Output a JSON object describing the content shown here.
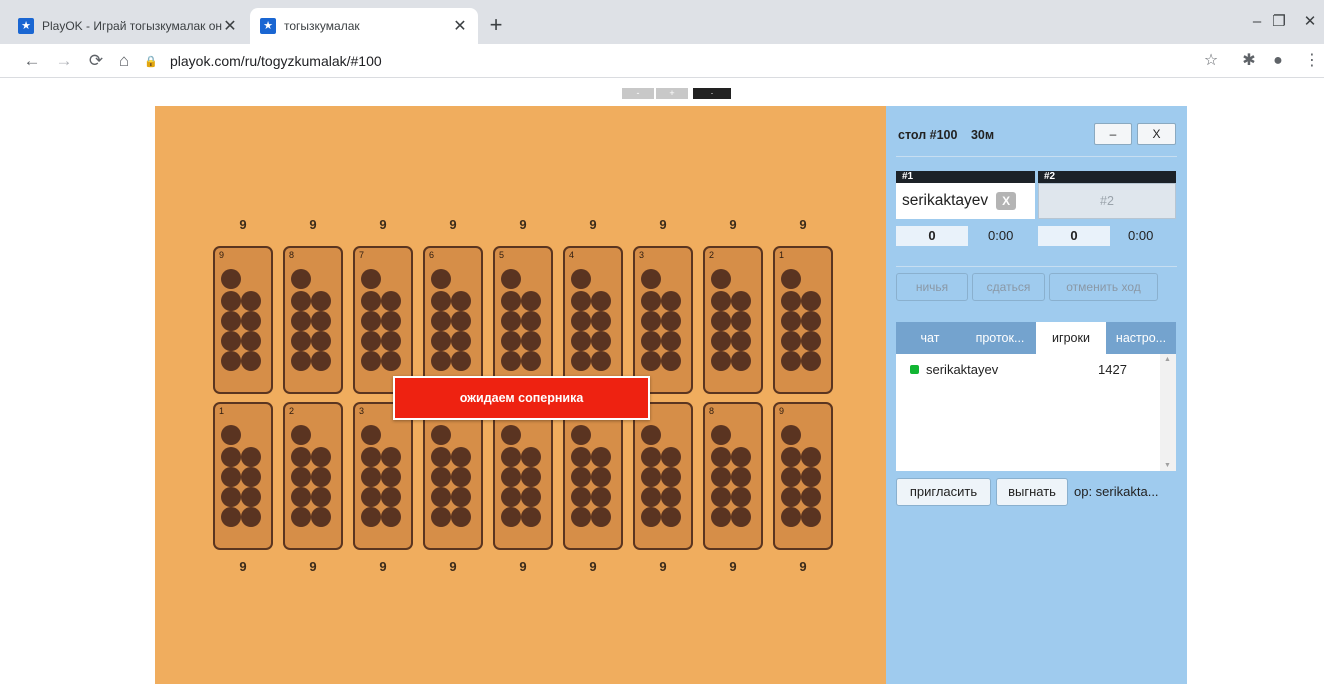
{
  "browser": {
    "tabs": [
      {
        "title": "PlayOK - Играй тогызкумалак он",
        "active": false
      },
      {
        "title": "тогызкумалак",
        "active": true
      }
    ],
    "new_tab": "+",
    "window_controls": {
      "minimize": "–",
      "restore": "❐",
      "close": "✕"
    },
    "url": "playok.com/ru/togyzkumalak/#100"
  },
  "page": {
    "zoom_controls": [
      "-",
      "+",
      "·"
    ],
    "board": {
      "top_counts": [
        "9",
        "9",
        "9",
        "9",
        "9",
        "9",
        "9",
        "9",
        "9"
      ],
      "top_pit_numbers": [
        "9",
        "8",
        "7",
        "6",
        "5",
        "4",
        "3",
        "2",
        "1"
      ],
      "bottom_counts": [
        "9",
        "9",
        "9",
        "9",
        "9",
        "9",
        "9",
        "9",
        "9"
      ],
      "bottom_pit_numbers": [
        "1",
        "2",
        "3",
        "4",
        "5",
        "6",
        "7",
        "8",
        "9"
      ],
      "stones_per_pit": 9,
      "status_message": "ожидаем соперника"
    },
    "panel": {
      "table_name": "стол #100",
      "time_control": "30м",
      "minimize_label": "–",
      "close_label": "X",
      "seat1_header": "#1",
      "seat2_header": "#2",
      "seat1_player": "serikaktayev",
      "kick_label": "X",
      "seat2_placeholder": "#2",
      "score1": "0",
      "timer1": "0:00",
      "score2": "0",
      "timer2": "0:00",
      "actions": [
        "ничья",
        "сдаться",
        "отменить ход"
      ],
      "tabs": [
        "чат",
        "проток...",
        "игроки",
        "настро..."
      ],
      "selected_tab": "игроки",
      "players": [
        {
          "name": "serikaktayev",
          "rating": "1427",
          "status_color": "#11b533"
        }
      ],
      "invite_label": "пригласить",
      "boot_label": "выгнать",
      "operator_text": "op: serikakta..."
    }
  },
  "colors": {
    "board": "#f0ad5e",
    "pit": "#d68e48",
    "stone": "#5a3421",
    "panel": "#9fcbee",
    "waiting": "#ee2211"
  }
}
